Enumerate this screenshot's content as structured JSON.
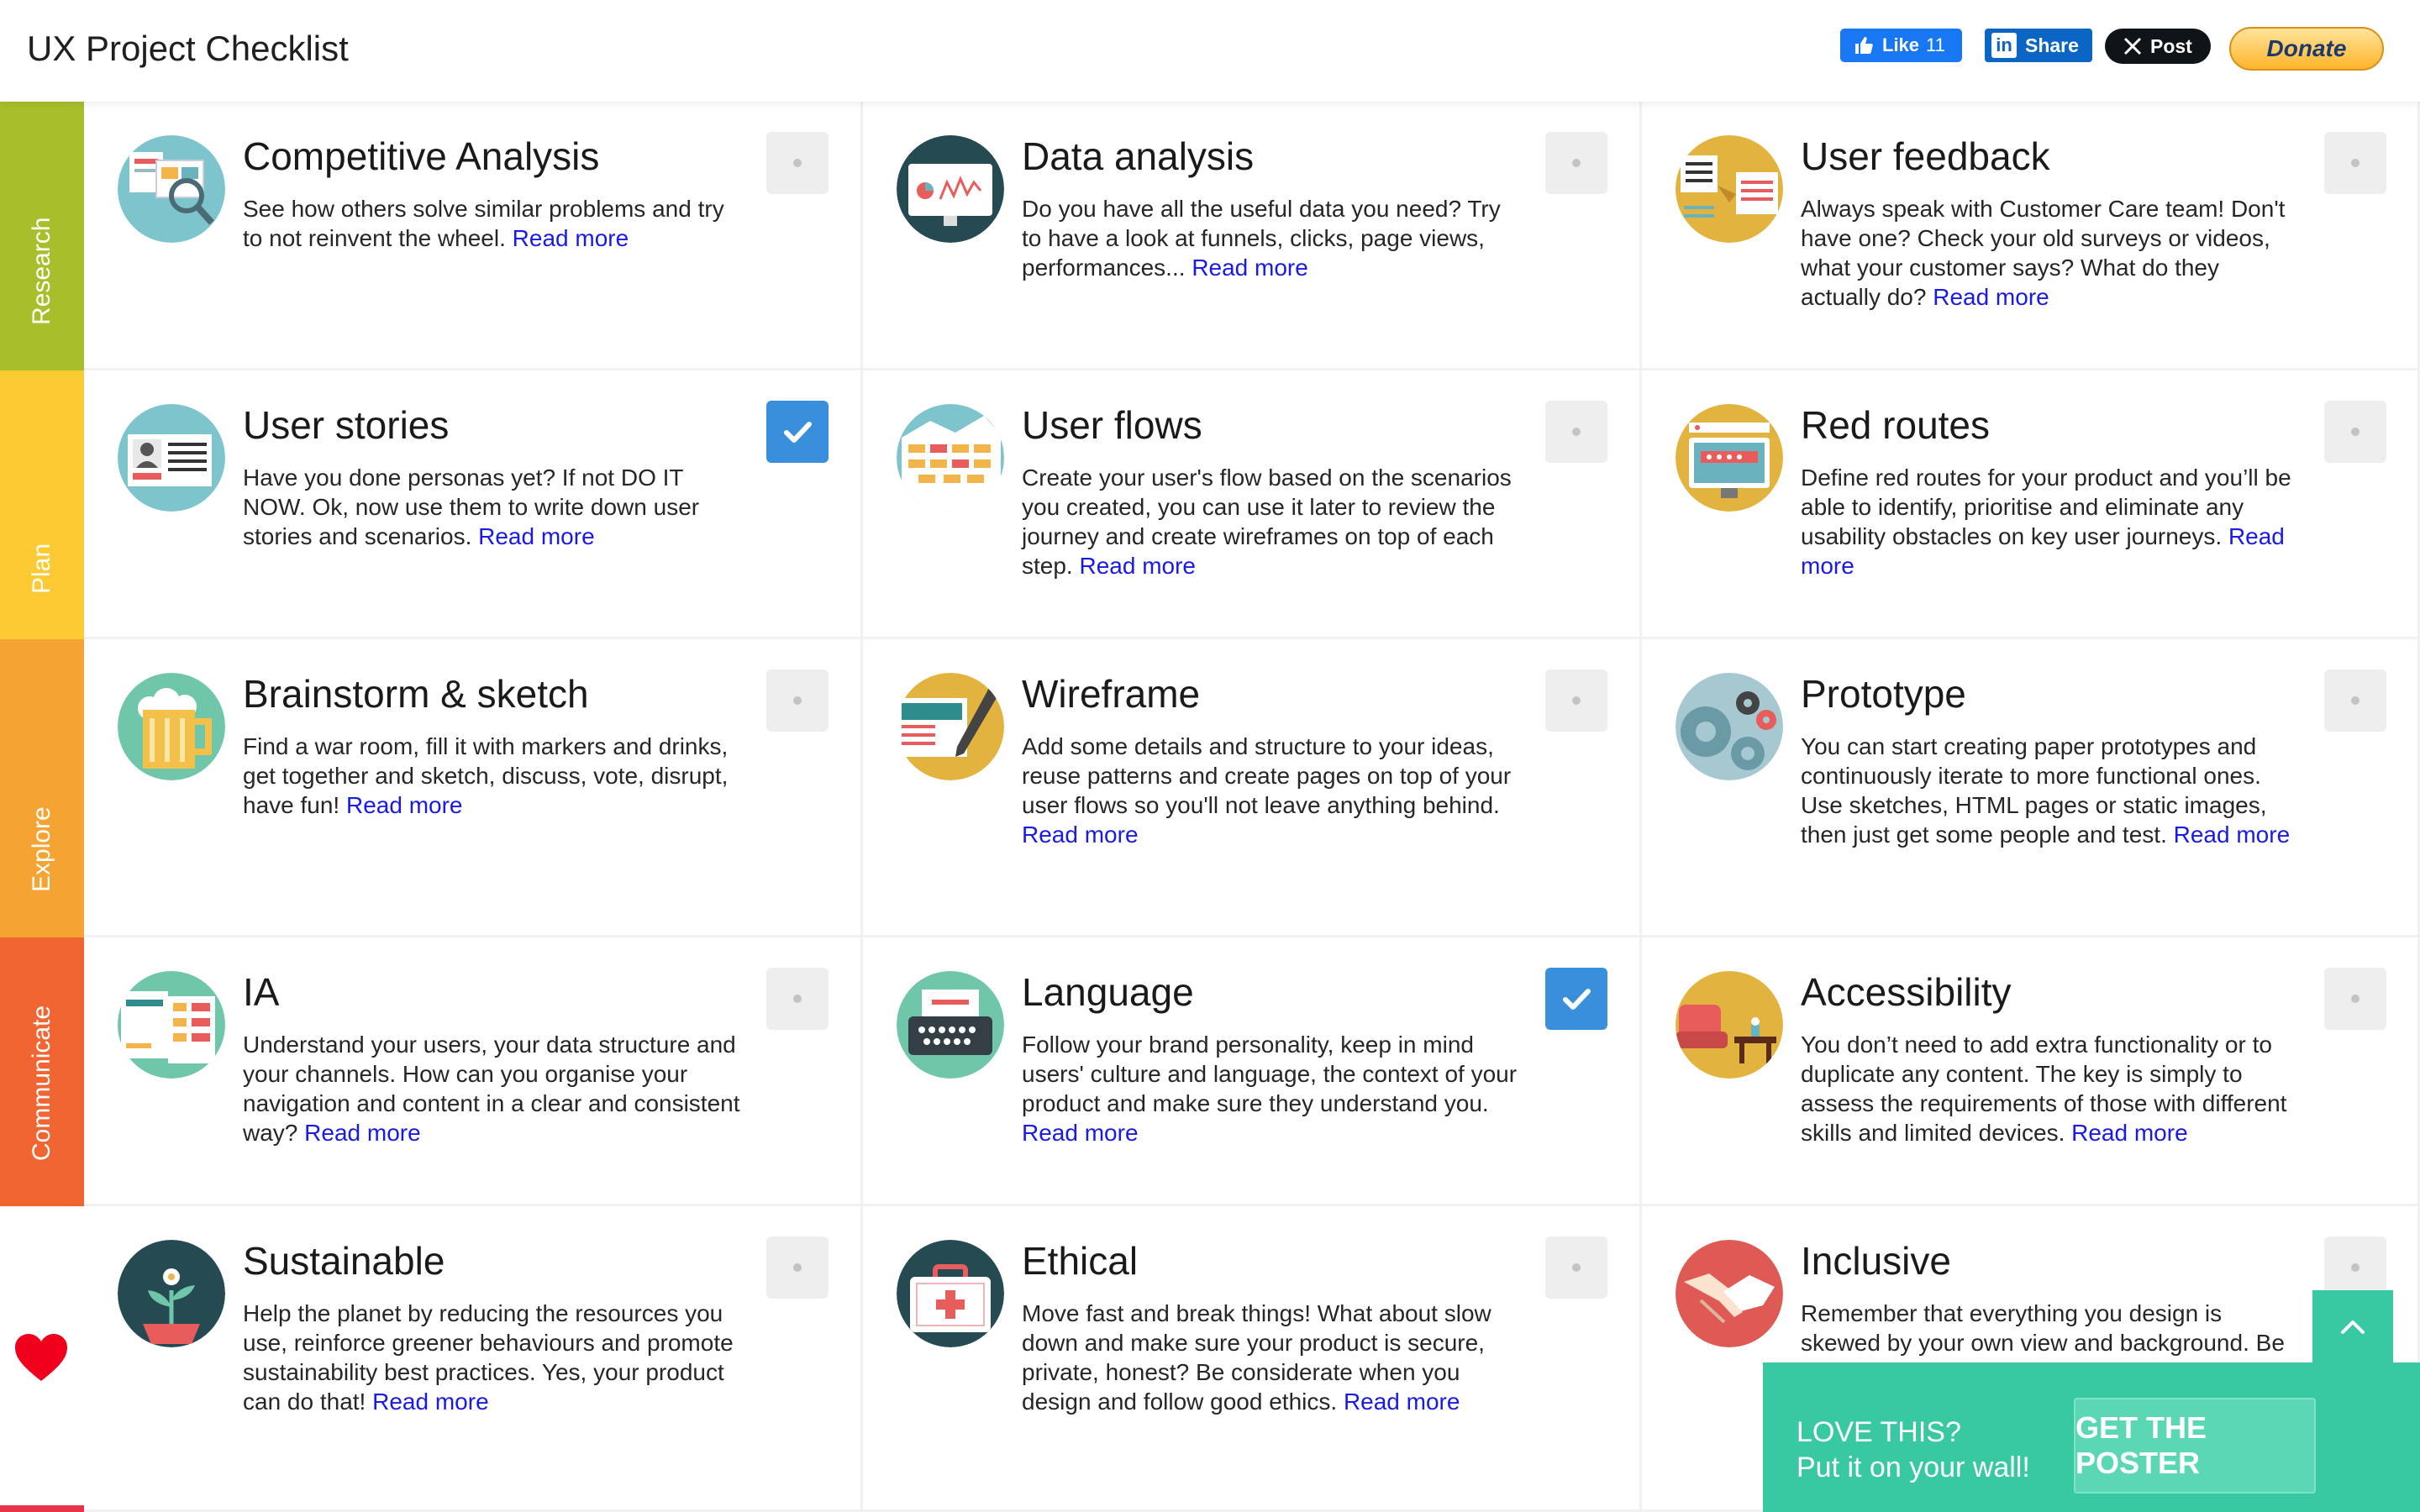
{
  "header": {
    "title": "UX Project Checklist",
    "like_label": "Like",
    "like_count": "11",
    "share_label": "Share",
    "post_label": "Post",
    "donate_label": "Donate"
  },
  "categories": [
    {
      "label": "Research",
      "color": "#a9be2b"
    },
    {
      "label": "Plan",
      "color": "#fccb33"
    },
    {
      "label": "Explore",
      "color": "#f5a433"
    },
    {
      "label": "Communicate",
      "color": "#f16532"
    }
  ],
  "read_more": "Read more",
  "cards": [
    {
      "title": "Competitive Analysis",
      "desc": "See how others solve similar problems and try to not reinvent the wheel.",
      "checked": false,
      "icon": "competitive-analysis-icon"
    },
    {
      "title": "Data analysis",
      "desc": "Do you have all the useful data you need? Try to have a look at funnels, clicks, page views, performances...",
      "checked": false,
      "icon": "data-analysis-icon"
    },
    {
      "title": "User feedback",
      "desc": "Always speak with Customer Care team! Don't have one? Check your old surveys or videos, what your customer says? What do they actually do?",
      "checked": false,
      "icon": "user-feedback-icon"
    },
    {
      "title": "User stories",
      "desc": "Have you done personas yet? If not DO IT NOW. Ok, now use them to write down user stories and scenarios.",
      "checked": true,
      "icon": "user-stories-icon"
    },
    {
      "title": "User flows",
      "desc": "Create your user's flow based on the scenarios you created, you can use it later to review the journey and create wireframes on top of each step.",
      "checked": false,
      "icon": "user-flows-icon"
    },
    {
      "title": "Red routes",
      "desc": "Define red routes for your product and you’ll be able to identify, prioritise and eliminate any usability obstacles on key user journeys.",
      "checked": false,
      "icon": "red-routes-icon"
    },
    {
      "title": "Brainstorm & sketch",
      "desc": "Find a war room, fill it with markers and drinks, get together and sketch, discuss, vote, disrupt, have fun!",
      "checked": false,
      "icon": "beer-icon"
    },
    {
      "title": "Wireframe",
      "desc": "Add some details and structure to your ideas, reuse patterns and create pages on top of your user flows so you'll not leave anything behind.",
      "checked": false,
      "icon": "wireframe-icon"
    },
    {
      "title": "Prototype",
      "desc": "You can start creating paper prototypes and continuously iterate to more functional ones. Use sketches, HTML pages or static images, then just get some people and test.",
      "checked": false,
      "icon": "gears-icon"
    },
    {
      "title": "IA",
      "desc": "Understand your users, your data structure and your channels. How can you organise your navigation and content in a clear and consistent way?",
      "checked": false,
      "icon": "ia-icon"
    },
    {
      "title": "Language",
      "desc": "Follow your brand personality, keep in mind users' culture and language, the context of your product and make sure they understand you.",
      "checked": true,
      "icon": "typewriter-icon"
    },
    {
      "title": "Accessibility",
      "desc": "You don’t need to add extra functionality or to duplicate any content. The key is simply to assess the requirements of those with different skills and limited devices.",
      "checked": false,
      "icon": "accessibility-icon"
    },
    {
      "title": "Sustainable",
      "desc": "Help the planet by reducing the resources you use, reinforce greener behaviours and promote sustainability best practices. Yes, your product can do that!",
      "checked": false,
      "icon": "plant-icon"
    },
    {
      "title": "Ethical",
      "desc": "Move fast and break things! What about slow down and make sure your product is secure, private, honest? Be considerate when you design and follow good ethics.",
      "checked": false,
      "icon": "first-aid-icon"
    },
    {
      "title": "Inclusive",
      "desc": "Remember that everything you design is skewed by your own view and background. Be",
      "checked": false,
      "icon": "handshake-icon"
    }
  ],
  "poster": {
    "line1": "LOVE THIS?",
    "line2": "Put it on your wall!",
    "button": "GET THE POSTER"
  }
}
